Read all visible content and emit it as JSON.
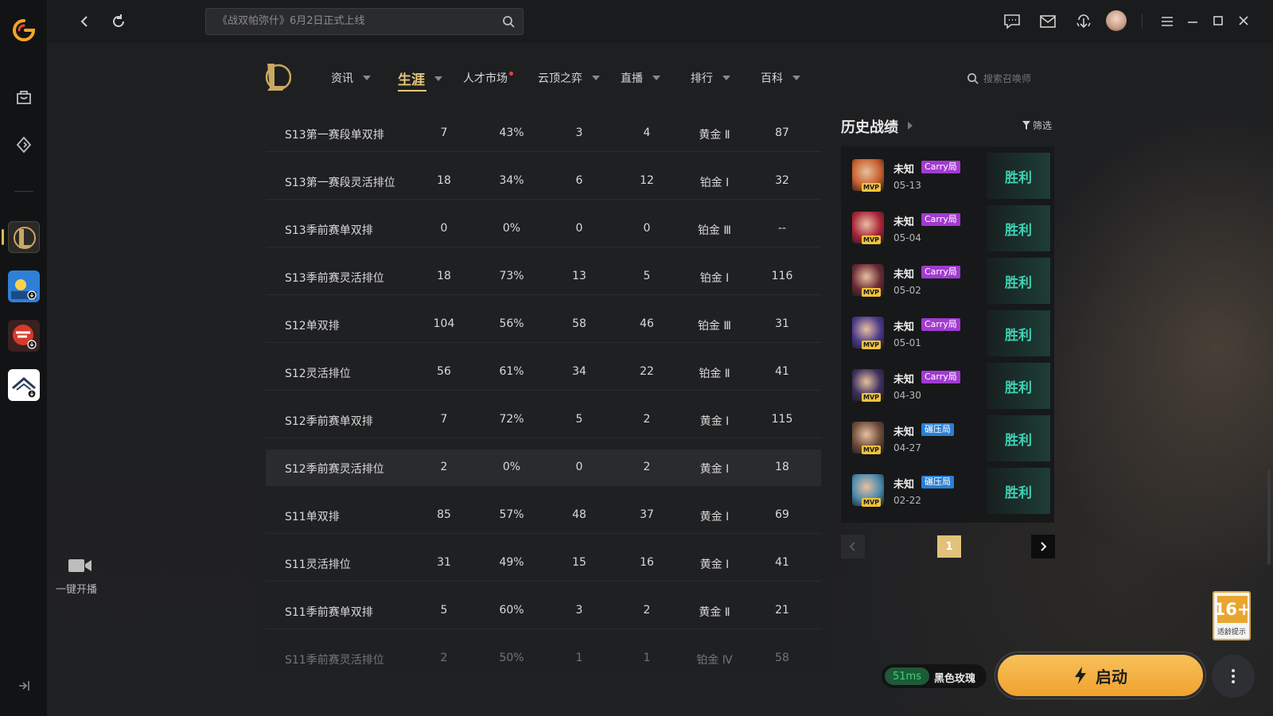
{
  "topbar": {
    "search_placeholder": "《战双帕弥什》6月2日正式上线"
  },
  "left_rail": {
    "live_label": "一键开播"
  },
  "game_nav": {
    "items": [
      {
        "label": "资讯",
        "active": false,
        "dot": false
      },
      {
        "label": "生涯",
        "active": true,
        "dot": false
      },
      {
        "label": "人才市场",
        "active": false,
        "dot": true
      },
      {
        "label": "云顶之弈",
        "active": false,
        "dot": false
      },
      {
        "label": "直播",
        "active": false,
        "dot": false
      },
      {
        "label": "排行",
        "active": false,
        "dot": false
      },
      {
        "label": "百科",
        "active": false,
        "dot": false
      }
    ],
    "summoner_search_placeholder": "搜索召唤师"
  },
  "season_table": {
    "rows": [
      {
        "name": "S13第一赛段单双排",
        "games": "7",
        "winrate": "43%",
        "wins": "3",
        "losses": "4",
        "rank": "黄金 Ⅱ",
        "points": "87"
      },
      {
        "name": "S13第一赛段灵活排位",
        "games": "18",
        "winrate": "34%",
        "wins": "6",
        "losses": "12",
        "rank": "铂金 Ⅰ",
        "points": "32"
      },
      {
        "name": "S13季前赛单双排",
        "games": "0",
        "winrate": "0%",
        "wins": "0",
        "losses": "0",
        "rank": "铂金 Ⅲ",
        "points": "--"
      },
      {
        "name": "S13季前赛灵活排位",
        "games": "18",
        "winrate": "73%",
        "wins": "13",
        "losses": "5",
        "rank": "铂金 Ⅰ",
        "points": "116"
      },
      {
        "name": "S12单双排",
        "games": "104",
        "winrate": "56%",
        "wins": "58",
        "losses": "46",
        "rank": "铂金 Ⅲ",
        "points": "31"
      },
      {
        "name": "S12灵活排位",
        "games": "56",
        "winrate": "61%",
        "wins": "34",
        "losses": "22",
        "rank": "铂金 Ⅱ",
        "points": "41"
      },
      {
        "name": "S12季前赛单双排",
        "games": "7",
        "winrate": "72%",
        "wins": "5",
        "losses": "2",
        "rank": "黄金 Ⅰ",
        "points": "115"
      },
      {
        "name": "S12季前赛灵活排位",
        "games": "2",
        "winrate": "0%",
        "wins": "0",
        "losses": "2",
        "rank": "黄金 Ⅰ",
        "points": "18"
      },
      {
        "name": "S11单双排",
        "games": "85",
        "winrate": "57%",
        "wins": "48",
        "losses": "37",
        "rank": "黄金 Ⅰ",
        "points": "69"
      },
      {
        "name": "S11灵活排位",
        "games": "31",
        "winrate": "49%",
        "wins": "15",
        "losses": "16",
        "rank": "黄金 Ⅰ",
        "points": "41"
      },
      {
        "name": "S11季前赛单双排",
        "games": "5",
        "winrate": "60%",
        "wins": "3",
        "losses": "2",
        "rank": "黄金 Ⅱ",
        "points": "21"
      },
      {
        "name": "S11季前赛灵活排位",
        "games": "2",
        "winrate": "50%",
        "wins": "1",
        "losses": "1",
        "rank": "铂金 Ⅳ",
        "points": "58"
      }
    ]
  },
  "history": {
    "title": "历史战绩",
    "filter_label": "筛选",
    "matches": [
      {
        "name": "未知",
        "tag": "Carry局",
        "tag_type": "carry",
        "date": "05-13",
        "result": "胜利",
        "mvp": "MVP",
        "color": "#c8602e"
      },
      {
        "name": "未知",
        "tag": "Carry局",
        "tag_type": "carry",
        "date": "05-04",
        "result": "胜利",
        "mvp": "MVP",
        "color": "#a8243a"
      },
      {
        "name": "未知",
        "tag": "Carry局",
        "tag_type": "carry",
        "date": "05-02",
        "result": "胜利",
        "mvp": "MVP",
        "color": "#6a2a34"
      },
      {
        "name": "未知",
        "tag": "Carry局",
        "tag_type": "carry",
        "date": "05-01",
        "result": "胜利",
        "mvp": "MVP",
        "color": "#4a3a8a"
      },
      {
        "name": "未知",
        "tag": "Carry局",
        "tag_type": "carry",
        "date": "04-30",
        "result": "胜利",
        "mvp": "MVP",
        "color": "#3d2f5e"
      },
      {
        "name": "未知",
        "tag": "碾压局",
        "tag_type": "crush",
        "date": "04-27",
        "result": "胜利",
        "mvp": "MVP",
        "color": "#6b4a3a"
      },
      {
        "name": "未知",
        "tag": "碾压局",
        "tag_type": "crush",
        "date": "02-22",
        "result": "胜利",
        "mvp": "MVP",
        "color": "#4a8ab0"
      }
    ],
    "page": "1"
  },
  "age_badge": {
    "rating": "16+",
    "note": "适龄提示"
  },
  "bottom": {
    "ping": "51ms",
    "server": "黑色玫瑰",
    "launch_label": "启动"
  }
}
